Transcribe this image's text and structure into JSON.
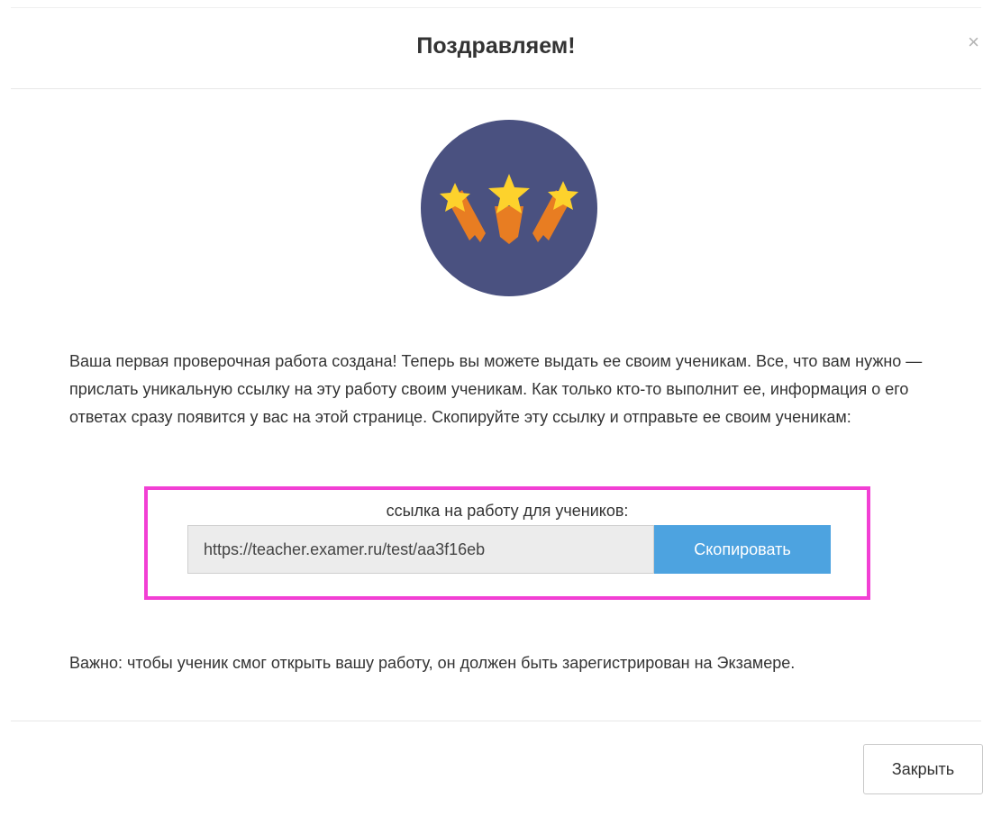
{
  "modal": {
    "title": "Поздравляем!",
    "close_glyph": "×"
  },
  "badge": {
    "icon": "stars-icon",
    "colors": {
      "circle": "#4a5180",
      "star": "#fdd22c",
      "tail": "#e87d22"
    }
  },
  "body": {
    "intro": "Ваша первая проверочная работа создана! Теперь вы можете выдать ее своим ученикам. Все, что вам нужно — прислать уникальную ссылку на эту работу своим ученикам. Как только кто-то выполнит ее, информация о его ответах сразу появится у вас на этой странице. Скопируйте эту ссылку и отправьте ее своим ученикам:",
    "link_label": "ссылка на работу для учеников:",
    "link_value": "https://teacher.examer.ru/test/aa3f16eb",
    "copy_label": "Скопировать",
    "note": "Важно: чтобы ученик смог открыть вашу работу, он должен быть зарегистрирован на Экзамере."
  },
  "footer": {
    "close_label": "Закрыть"
  },
  "colors": {
    "highlight_border": "#f23fd4",
    "copy_button": "#4da3e0"
  }
}
